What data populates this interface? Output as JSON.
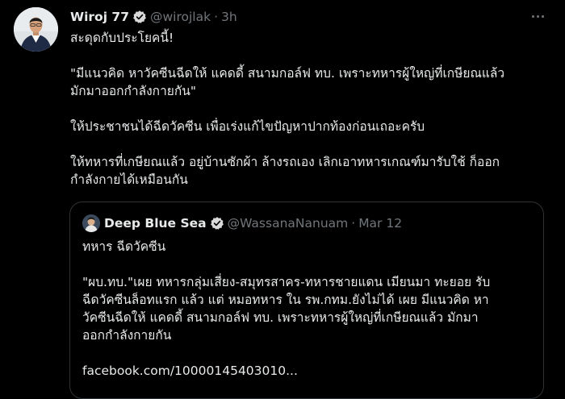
{
  "tweet": {
    "author_name": "Wiroj 77",
    "author_handle": "@wirojlak",
    "time": "3h",
    "text": {
      "line1": "สะดุดกับประโยคนี้!",
      "line2": "\"มีแนวคิด หาวัคซีนฉีดให้ แคดดี้  สนามกอล์ฟ ทบ. เพราะทหารผู้ใหญ่ที่เกษียณแล้ว",
      "line3": "มักมาออกกำลังกายกัน\"",
      "line4": "ให้ประชาชนได้ฉีดวัคซีน เพื่อเร่งแก้ไขปัญหาปากท้องก่อนเถอะครับ",
      "line5": "ให้ทหารที่เกษียณแล้ว อยู่บ้านซักผ้า ล้างรถเอง เลิกเอาทหารเกณฑ์มารับใช้ ก็ออก",
      "line6": "กำลังกายได้เหมือนกัน"
    }
  },
  "quoted": {
    "author_name": "Deep Blue Sea",
    "author_handle": "@WassanaNanuam",
    "date": "Mar 12",
    "text": {
      "line1": "ทหาร ฉีดวัคซีน",
      "line2": "\"ผบ.ทบ.\"เผย  ทหารกลุ่มเสี่ยง-สมุทรสาคร-ทหารชายแดน เมียนมา ทะยอย รับ",
      "line3": "ฉีดวัคซีนล็อทแรก แล้ว แต่ หมอทหาร ใน รพ.กทม.ยังไม่ได้ เผย มีแนวคิด หา",
      "line4": "วัคซีนฉีดให้ แคดดี้  สนามกอล์ฟ ทบ. เพราะทหารผู้ใหญ่ที่เกษียณแล้ว มักมา",
      "line5": "ออกกำลังกายกัน",
      "link": "facebook.com/10000145403010..."
    }
  },
  "icons": {
    "verified": "verified-badge-icon",
    "more": "more-options-icon"
  },
  "colors": {
    "background": "#000000",
    "text": "#e7e9ea",
    "muted": "#71767b",
    "border": "#2f3336"
  }
}
